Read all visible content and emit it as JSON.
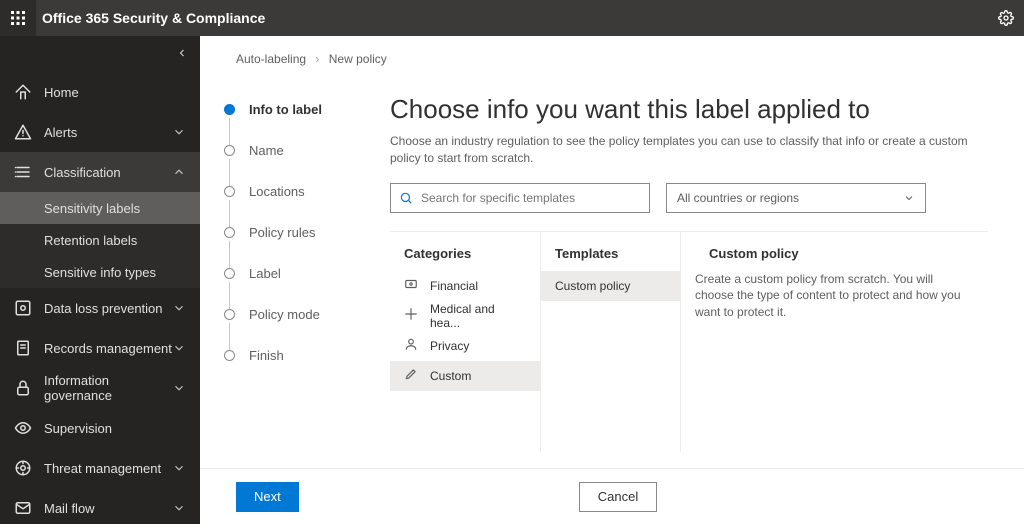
{
  "topbar": {
    "title": "Office 365 Security & Compliance"
  },
  "sidebar": {
    "items": [
      {
        "icon": "home",
        "label": "Home",
        "expandable": false
      },
      {
        "icon": "alert",
        "label": "Alerts",
        "expandable": true
      },
      {
        "icon": "classify",
        "label": "Classification",
        "expandable": true,
        "expanded": true,
        "children": [
          {
            "label": "Sensitivity labels",
            "active": true
          },
          {
            "label": "Retention labels"
          },
          {
            "label": "Sensitive info types"
          }
        ]
      },
      {
        "icon": "dlp",
        "label": "Data loss prevention",
        "expandable": true
      },
      {
        "icon": "records",
        "label": "Records management",
        "expandable": true
      },
      {
        "icon": "lock",
        "label": "Information governance",
        "expandable": true
      },
      {
        "icon": "eye",
        "label": "Supervision",
        "expandable": false
      },
      {
        "icon": "threat",
        "label": "Threat management",
        "expandable": true
      },
      {
        "icon": "mail",
        "label": "Mail flow",
        "expandable": true
      }
    ]
  },
  "breadcrumb": {
    "parent": "Auto-labeling",
    "current": "New policy"
  },
  "steps": [
    {
      "name": "Info to label",
      "current": true
    },
    {
      "name": "Name"
    },
    {
      "name": "Locations"
    },
    {
      "name": "Policy rules"
    },
    {
      "name": "Label"
    },
    {
      "name": "Policy mode"
    },
    {
      "name": "Finish"
    }
  ],
  "content": {
    "heading": "Choose info you want this label applied to",
    "description": "Choose an industry regulation to see the policy templates you can use to classify that info or create a custom policy to start from scratch.",
    "search_placeholder": "Search for specific templates",
    "region_selected": "All countries or regions",
    "categories_header": "Categories",
    "templates_header": "Templates",
    "custom_header": "Custom policy",
    "custom_desc": "Create a custom policy from scratch. You will choose the type of content to protect and how you want to protect it.",
    "categories": [
      {
        "icon": "finance",
        "label": "Financial"
      },
      {
        "icon": "medical",
        "label": "Medical and hea..."
      },
      {
        "icon": "privacy",
        "label": "Privacy"
      },
      {
        "icon": "custom",
        "label": "Custom",
        "selected": true
      }
    ],
    "templates": [
      {
        "label": "Custom policy",
        "selected": true
      }
    ]
  },
  "footer": {
    "next": "Next",
    "cancel": "Cancel"
  }
}
